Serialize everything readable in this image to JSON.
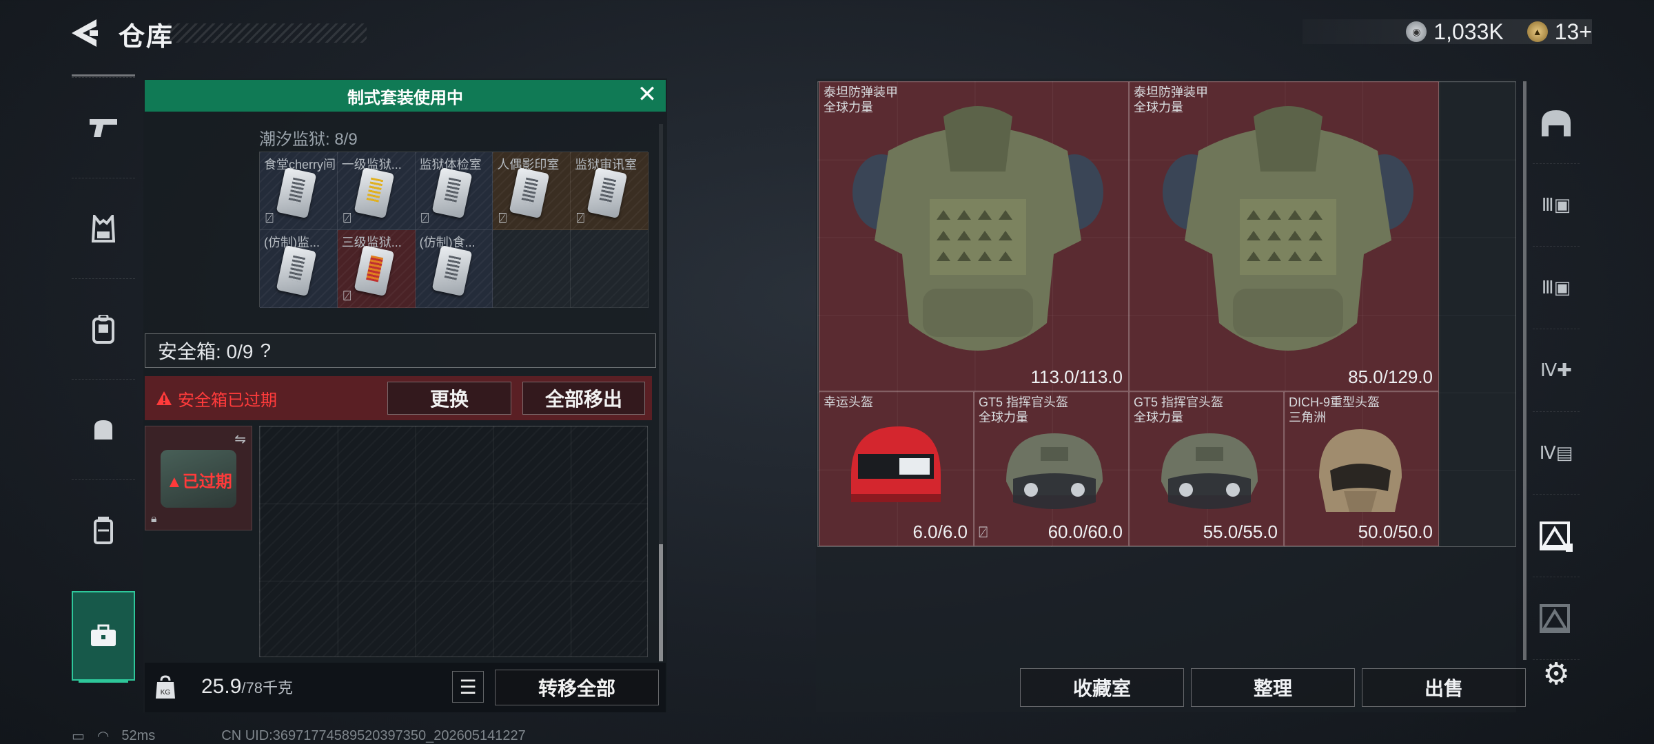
{
  "header": {
    "title": "仓库",
    "currency": [
      {
        "icon": "silver-coin-icon",
        "value": "1,033K"
      },
      {
        "icon": "gold-coin-icon",
        "value": "13+"
      }
    ]
  },
  "left_rail": {
    "items": [
      {
        "name": "weapon",
        "icon": "pistol-icon"
      },
      {
        "name": "vest",
        "icon": "chest-rig-icon"
      },
      {
        "name": "backpack",
        "icon": "backpack-icon"
      },
      {
        "name": "pouch",
        "icon": "pouch-icon"
      },
      {
        "name": "container",
        "icon": "container-icon"
      },
      {
        "name": "case",
        "icon": "briefcase-icon"
      }
    ]
  },
  "loadout_panel": {
    "banner": "制式套装使用中",
    "container_title": "潮汐监狱: 8/9",
    "container_items": [
      {
        "label": "食堂cherry间",
        "color": "blue",
        "card": "white"
      },
      {
        "label": "一级监狱...",
        "color": "blue",
        "card": "yellow"
      },
      {
        "label": "监狱体检室",
        "color": "blue",
        "card": "white"
      },
      {
        "label": "人偶影印室",
        "color": "brown",
        "card": "white"
      },
      {
        "label": "监狱审讯室",
        "color": "brown",
        "card": "white"
      },
      {
        "label": "(仿制)监...",
        "color": "blue",
        "card": "white"
      },
      {
        "label": "三级监狱...",
        "color": "red",
        "card": "red"
      },
      {
        "label": "(仿制)食...",
        "color": "blue",
        "card": "white"
      }
    ],
    "safebox_label": "安全箱: 0/9",
    "safebox_help": "?",
    "expired_warning": "安全箱已过期",
    "replace_button": "更换",
    "move_all_button": "全部移出",
    "safebox_thumb_label": "已过期",
    "weight_value": "25.9",
    "weight_max": "/78千克",
    "transfer_all_button": "转移全部"
  },
  "equipment": [
    {
      "name": "泰坦防弹装甲",
      "sub": "全球力量",
      "durability": "113.0/113.0",
      "type": "armor"
    },
    {
      "name": "泰坦防弹装甲",
      "sub": "全球力量",
      "durability": "85.0/129.0",
      "type": "armor"
    },
    {
      "name": "幸运头盔",
      "sub": "",
      "durability": "6.0/6.0",
      "type": "helmet-red"
    },
    {
      "name": "GT5 指挥官头盔",
      "sub": "全球力量",
      "durability": "60.0/60.0",
      "type": "helmet-gray"
    },
    {
      "name": "GT5 指挥官头盔",
      "sub": "全球力量",
      "durability": "55.0/55.0",
      "type": "helmet-gray"
    },
    {
      "name": "DICH-9重型头盔",
      "sub": "三角洲",
      "durability": "50.0/50.0",
      "type": "helmet-tan"
    }
  ],
  "right_rail": {
    "items": [
      {
        "icon": "dome-icon"
      },
      {
        "icon": "tier3-bag-icon"
      },
      {
        "icon": "tier3-bag-2-icon"
      },
      {
        "icon": "tier4-medkit-icon"
      },
      {
        "icon": "tier4-folder-icon"
      },
      {
        "icon": "stash-selected-icon"
      },
      {
        "icon": "stash-dim-icon"
      },
      {
        "icon": "gear-icon"
      }
    ]
  },
  "bottom_buttons": {
    "collection": "收藏室",
    "organize": "整理",
    "sell": "出售"
  },
  "status_bar": {
    "ping": "52ms",
    "uid": "CN UID:36971774589520397350_202605141227"
  }
}
